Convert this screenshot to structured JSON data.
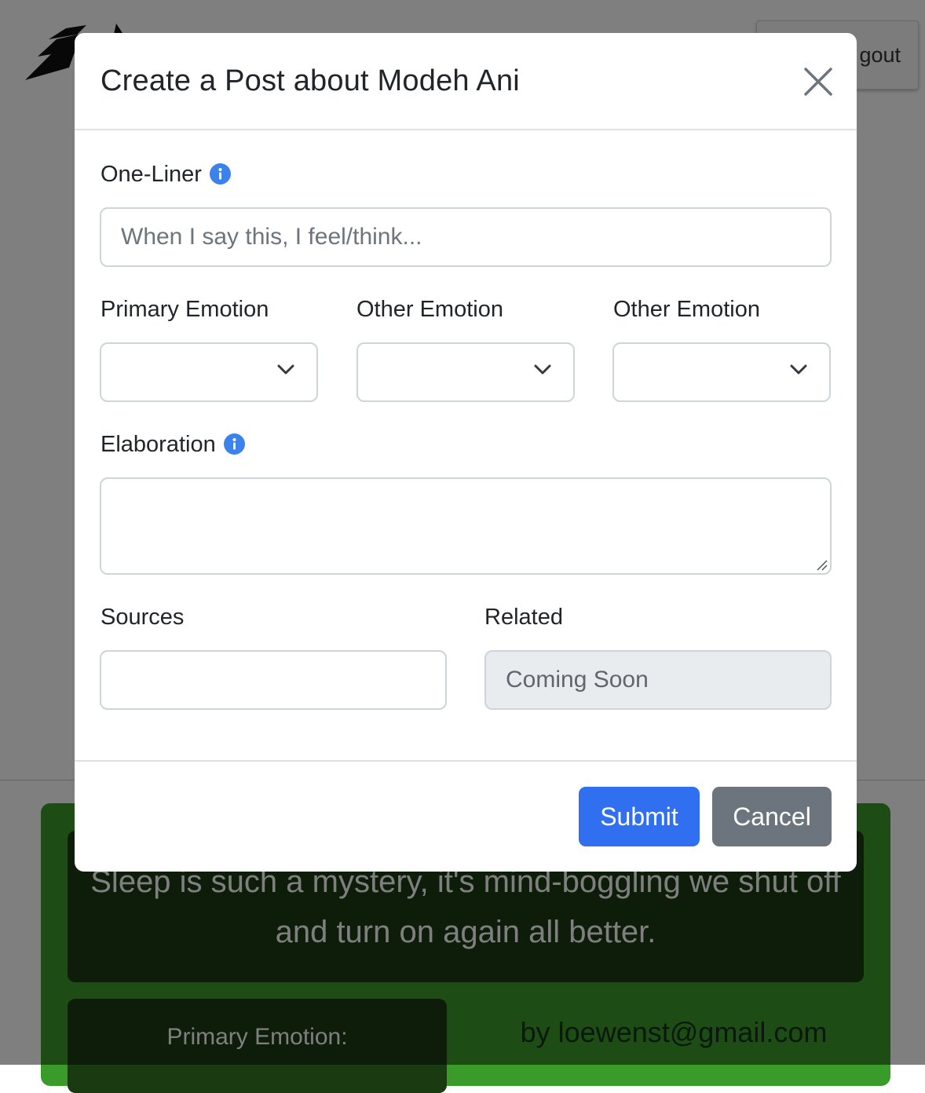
{
  "background": {
    "logout_label": "gout",
    "post": {
      "quote": "Sleep is such a mystery, it's mind-boggling we shut off and turn on again all better.",
      "primary_emotion_label": "Primary Emotion:",
      "author": "by loewenst@gmail.com"
    }
  },
  "modal": {
    "title": "Create a Post about Modeh Ani",
    "one_liner": {
      "label": "One-Liner",
      "placeholder": "When I say this, I feel/think..."
    },
    "emotions": [
      {
        "label": "Primary Emotion",
        "selected": ""
      },
      {
        "label": "Other Emotion",
        "selected": ""
      },
      {
        "label": "Other Emotion",
        "selected": ""
      }
    ],
    "elaboration": {
      "label": "Elaboration",
      "value": ""
    },
    "sources": {
      "label": "Sources",
      "value": ""
    },
    "related": {
      "label": "Related",
      "value": "Coming Soon"
    },
    "submit_label": "Submit",
    "cancel_label": "Cancel"
  },
  "colors": {
    "primary": "#2f6ff0",
    "secondary": "#6c757d",
    "info_icon": "#3b82ec",
    "post_card": "#3a9a2a"
  },
  "icons": [
    "close-icon",
    "info-icon",
    "chevron-down-icon",
    "resize-grip-icon",
    "logo-icon"
  ]
}
